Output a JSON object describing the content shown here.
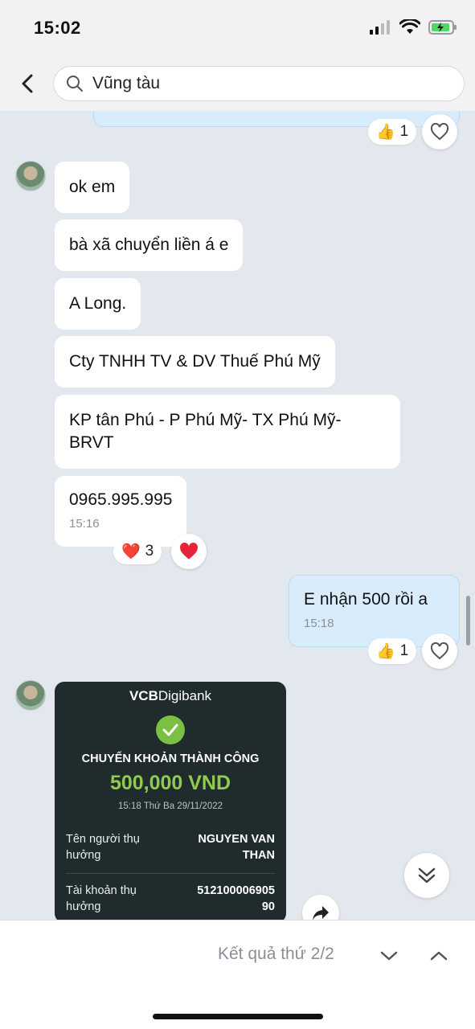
{
  "status_bar": {
    "time": "15:02"
  },
  "search": {
    "value": "Vũng tàu"
  },
  "messages": [
    {
      "text": "ok em"
    },
    {
      "text": "bà xã chuyển liền á e"
    },
    {
      "text": "A Long."
    },
    {
      "text": "Cty TNHH TV & DV Thuế Phú Mỹ"
    },
    {
      "text_line1": "KP tân Phú - P Phú Mỹ- TX Phú Mỹ-",
      "text_line2": "BRVT"
    },
    {
      "text": "0965.995.995",
      "time": "15:16"
    },
    {
      "text": "E nhận 500 rồi a",
      "time": "15:18"
    }
  ],
  "reactions": {
    "top_like_count": "1",
    "heart_count": "3",
    "mine_like_count": "1"
  },
  "transfer_card": {
    "brand_bold": "VCB",
    "brand_light": "Digibank",
    "title": "CHUYỂN KHOẢN THÀNH CÔNG",
    "amount": "500,000 VND",
    "datetime": "15:18 Thứ Ba 29/11/2022",
    "receiver_label_1": "Tên người thụ",
    "receiver_label_2": "hưởng",
    "receiver_value_1": "NGUYEN VAN",
    "receiver_value_2": "THAN",
    "account_label_1": "Tài khoản thụ",
    "account_label_2": "hưởng",
    "account_value_1": "512100006905",
    "account_value_2": "90"
  },
  "bottom": {
    "result_text": "Kết quả thứ 2/2"
  },
  "colors": {
    "accent_green": "#8fcb4c",
    "bubble_mine": "#d9ecfb",
    "chat_bg": "#e3e7ee"
  }
}
